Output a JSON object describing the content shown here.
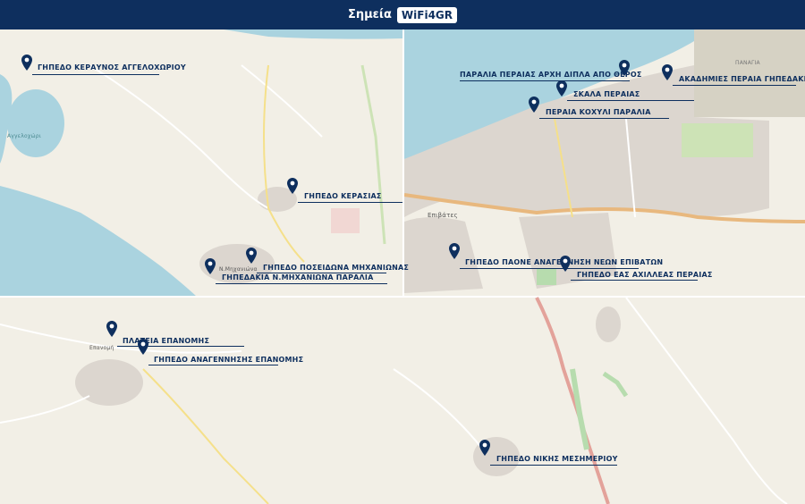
{
  "header": {
    "title": "Σημεία",
    "badge": "WiFi4GR"
  },
  "colors": {
    "header_bg": "#0e2f5e",
    "pin": "#0e2f5e",
    "water": "#aad3df",
    "land": "#f2efe6",
    "urban": "#dcd6cf"
  },
  "map_labels": {
    "angelochori": "Αγγελοχώρι",
    "epivates": "Επιβάτες",
    "michaniona": "Ν.Μηχανιώνα",
    "epanomi": "Επανομή",
    "region": "ΠΑΝΑΓΙΑ"
  },
  "markers": [
    {
      "id": "keraunos",
      "label": "ΓΗΠΕΔΟ ΚΕΡΑΥΝΟΣ ΑΓΓΕΛΟΧΩΡΙΟΥ"
    },
    {
      "id": "paralia-arxi",
      "label": "ΠΑΡΑΛΙΑ ΠΕΡΑΙΑΣ ΑΡΧΗ ΔΙΠΛΑ ΑΠΟ ΘΕΡΟΣ"
    },
    {
      "id": "akadimies",
      "label": "ΑΚΑΔΗΜΙΕΣ ΠΕΡΑΙΑ ΓΗΠΕΔΑΚΙΑ"
    },
    {
      "id": "skala",
      "label": "ΣΚΑΛΑ ΠΕΡΑΙΑΣ"
    },
    {
      "id": "kochyli",
      "label": "ΠΕΡΑΙΑ ΚΟΧΥΛΙ ΠΑΡΑΛΙΑ"
    },
    {
      "id": "kerasia",
      "label": "ΓΗΠΕΔΟ ΚΕΡΑΣΙΑΣ"
    },
    {
      "id": "paone",
      "label": "ΓΗΠΕΔΟ ΠΑΟΝΕ ΑΝΑΓΕΝΝΗΣΗ ΝΕΩΝ ΕΠΙΒΑΤΩΝ"
    },
    {
      "id": "poseidona",
      "label": "ΓΗΠΕΔΟ ΠΟΣΕΙΔΩΝΑ ΜΗΧΑΝΙΩΝΑΣ"
    },
    {
      "id": "michaniona-gip",
      "label": "ΓΗΠΕΔΑΚΙΑ Ν.ΜΗΧΑΝΙΩΝΑ ΠΑΡΑΛΙΑ"
    },
    {
      "id": "achilleas",
      "label": "ΓΗΠΕΔΟ ΕΑΣ ΑΧΙΛΛΕΑΣ ΠΕΡΑΙΑΣ"
    },
    {
      "id": "plateia-epanomis",
      "label": "ΠΛΑΤΕΙΑ ΕΠΑΝΟΜΗΣ"
    },
    {
      "id": "anagennisi-epanomis",
      "label": "ΓΗΠΕΔΟ ΑΝΑΓΕΝΝΗΣΗΣ ΕΠΑΝΟΜΗΣ"
    },
    {
      "id": "niki",
      "label": "ΓΗΠΕΔΟ ΝΙΚΗΣ ΜΕΣΗΜΕΡΙΟΥ"
    }
  ]
}
